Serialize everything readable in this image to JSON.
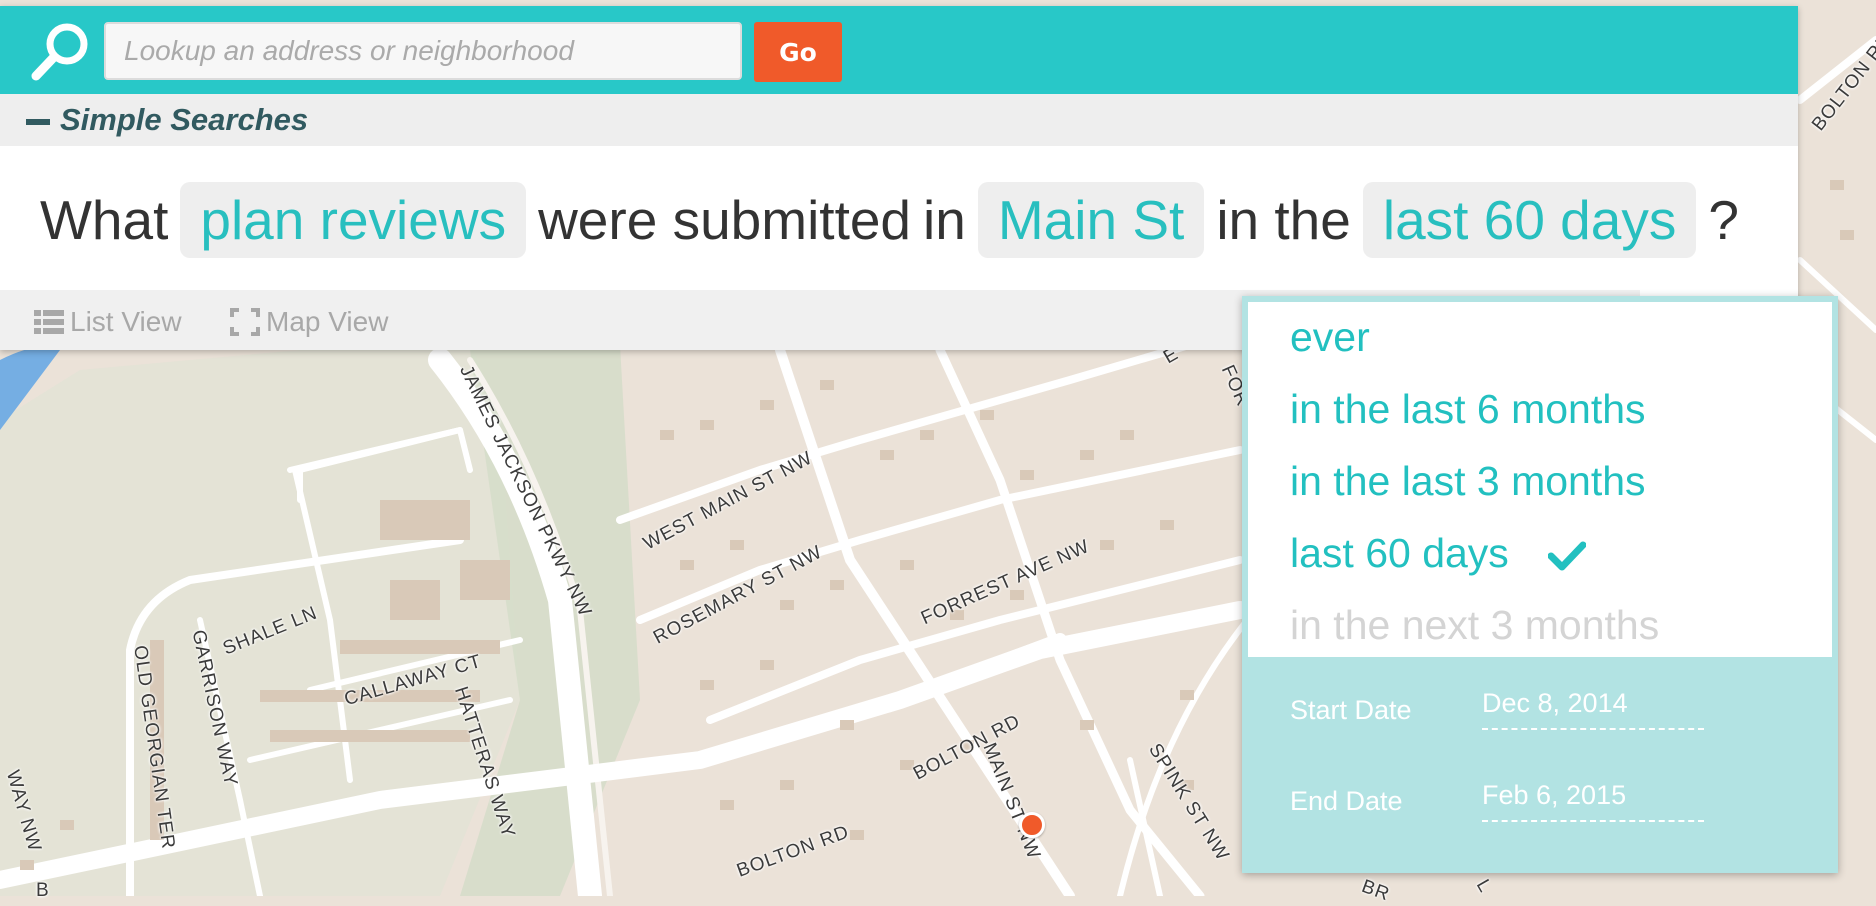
{
  "search": {
    "placeholder": "Lookup an address or neighborhood",
    "go_label": "Go"
  },
  "simple_searches": {
    "title": "Simple Searches"
  },
  "query": {
    "what": "What",
    "type_value": "plan reviews",
    "were_submitted": "were submitted",
    "in": "in",
    "location_value": "Main St",
    "in_the": "in the",
    "time_value": "last 60 days",
    "question_mark": "?"
  },
  "views": {
    "list": "List View",
    "map": "Map View"
  },
  "time_options": [
    {
      "label": "ever",
      "selected": false,
      "enabled": true
    },
    {
      "label": "in the last 6 months",
      "selected": false,
      "enabled": true
    },
    {
      "label": "in the last 3 months",
      "selected": false,
      "enabled": true
    },
    {
      "label": "last 60 days",
      "selected": true,
      "enabled": true
    },
    {
      "label": "in the next 3 months",
      "selected": false,
      "enabled": false
    }
  ],
  "dates": {
    "start_label": "Start Date",
    "start_value": "Dec 8, 2014",
    "end_label": "End Date",
    "end_value": "Feb 6, 2015"
  },
  "map": {
    "streets": [
      "JAMES JACKSON PKWY NW",
      "WEST MAIN ST NW",
      "ROSEMARY ST NW",
      "FORREST AVE NW",
      "SHALE LN",
      "CALLAWAY CT",
      "GARRISON WAY",
      "HATTERAS WAY",
      "OLD GEORGIAN TER",
      "BOLTON RD",
      "BOLTON RD",
      "MAIN ST NW",
      "SPINK ST NW",
      "BOLTON RD",
      "WAY NW",
      "B",
      "BR",
      "L",
      "FOR",
      "E"
    ]
  },
  "colors": {
    "header": "#28c8c8",
    "accent": "#22c0c0",
    "go_button": "#f05a2a",
    "map_land": "#ebe2d8",
    "dropdown_footer": "#b2e3e3"
  }
}
